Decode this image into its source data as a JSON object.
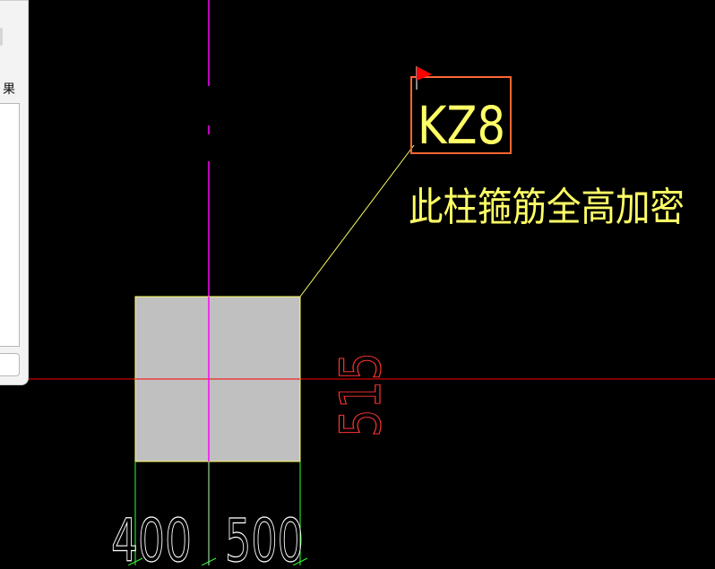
{
  "side_panel": {
    "label": "果"
  },
  "cad": {
    "column_tag": "KZ8",
    "note": "此柱箍筋全高加密",
    "dim_vertical": "515",
    "dim_bottom_left": "400",
    "dim_bottom_right": "500",
    "colors": {
      "background": "#000000",
      "axis_magenta": "#ff00ff",
      "axis_red": "#ff0000",
      "text_yellow": "#ffff66",
      "column_fill": "#c0c0c0",
      "column_outline": "#ffff66",
      "tag_box": "#ff6633",
      "dim_green": "#33ff33",
      "dim_white": "#ffffff",
      "flag_red": "#ff0000"
    }
  }
}
